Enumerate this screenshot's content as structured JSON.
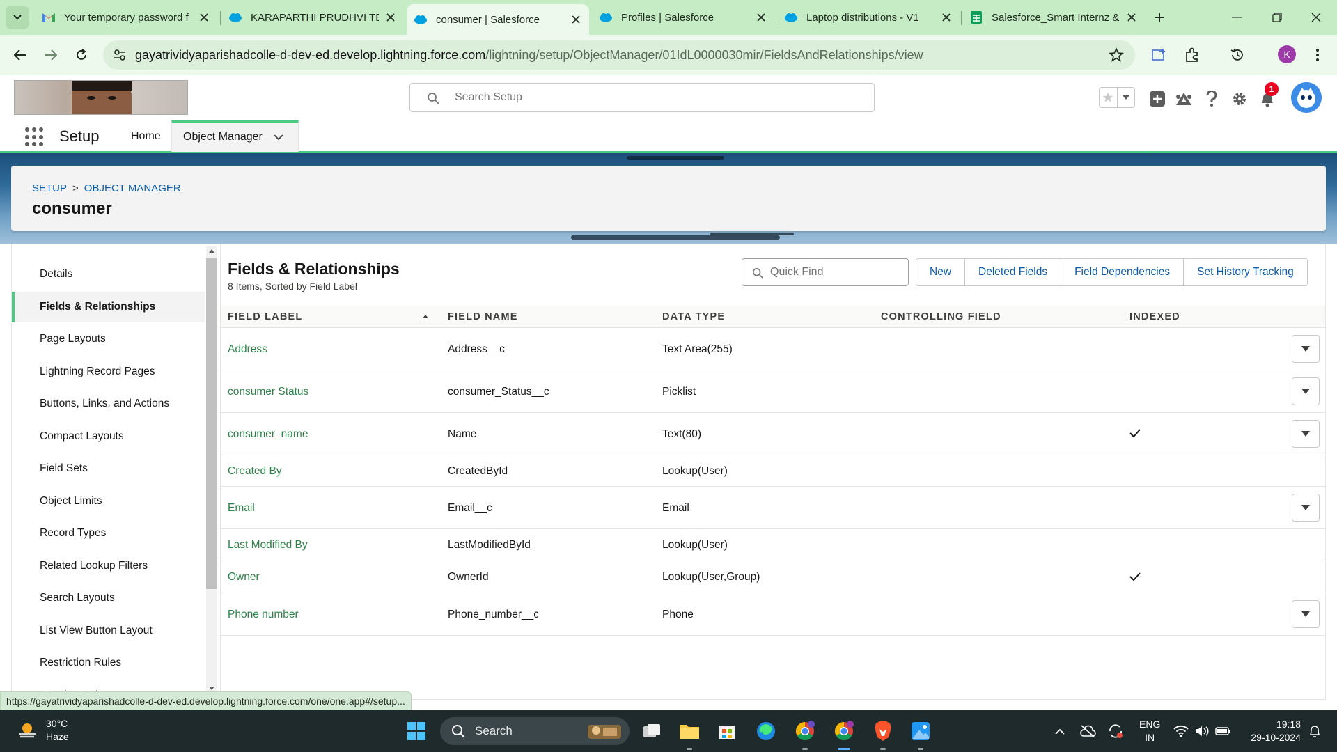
{
  "browser": {
    "tabs": [
      {
        "title": "Your temporary password f",
        "icon": "gmail-icon"
      },
      {
        "title": "KARAPARTHI PRUDHVI TEJ",
        "icon": "salesforce-cloud-icon"
      },
      {
        "title": "consumer | Salesforce",
        "icon": "salesforce-cloud-icon",
        "active": true
      },
      {
        "title": "Profiles | Salesforce",
        "icon": "salesforce-cloud-icon"
      },
      {
        "title": "Laptop distributions - V1",
        "icon": "salesforce-cloud-icon"
      },
      {
        "title": "Salesforce_Smart Internz &",
        "icon": "google-sheets-icon"
      }
    ],
    "url_host": "gayatrividyaparishadcolle-d-dev-ed.develop.lightning.force.com",
    "url_path": "/lightning/setup/ObjectManager/01IdL0000030mir/FieldsAndRelationships/view",
    "profile_initial": "K",
    "status_url": "https://gayatrividyaparishadcolle-d-dev-ed.develop.lightning.force.com/one/one.app#/setup..."
  },
  "header": {
    "search_placeholder": "Search Setup",
    "notification_count": "1"
  },
  "appnav": {
    "app_name": "Setup",
    "items": [
      {
        "label": "Home"
      },
      {
        "label": "Object Manager",
        "active": true
      }
    ]
  },
  "page": {
    "breadcrumb": [
      "SETUP",
      "OBJECT MANAGER"
    ],
    "title": "consumer"
  },
  "sidebar": {
    "items": [
      {
        "label": "Details"
      },
      {
        "label": "Fields & Relationships",
        "active": true
      },
      {
        "label": "Page Layouts"
      },
      {
        "label": "Lightning Record Pages"
      },
      {
        "label": "Buttons, Links, and Actions"
      },
      {
        "label": "Compact Layouts"
      },
      {
        "label": "Field Sets"
      },
      {
        "label": "Object Limits"
      },
      {
        "label": "Record Types"
      },
      {
        "label": "Related Lookup Filters"
      },
      {
        "label": "Search Layouts"
      },
      {
        "label": "List View Button Layout"
      },
      {
        "label": "Restriction Rules"
      },
      {
        "label": "Scoping Rules"
      }
    ]
  },
  "fields": {
    "title": "Fields & Relationships",
    "subtitle": "8 Items, Sorted by Field Label",
    "quick_find_placeholder": "Quick Find",
    "buttons": [
      "New",
      "Deleted Fields",
      "Field Dependencies",
      "Set History Tracking"
    ],
    "columns": [
      "FIELD LABEL",
      "FIELD NAME",
      "DATA TYPE",
      "CONTROLLING FIELD",
      "INDEXED"
    ],
    "rows": [
      {
        "label": "Address",
        "name": "Address__c",
        "type": "Text Area(255)",
        "controlling": "",
        "indexed": false,
        "menu": true
      },
      {
        "label": "consumer Status",
        "name": "consumer_Status__c",
        "type": "Picklist",
        "controlling": "",
        "indexed": false,
        "menu": true
      },
      {
        "label": "consumer_name",
        "name": "Name",
        "type": "Text(80)",
        "controlling": "",
        "indexed": true,
        "menu": true
      },
      {
        "label": "Created By",
        "name": "CreatedById",
        "type": "Lookup(User)",
        "controlling": "",
        "indexed": false,
        "menu": false
      },
      {
        "label": "Email",
        "name": "Email__c",
        "type": "Email",
        "controlling": "",
        "indexed": false,
        "menu": true
      },
      {
        "label": "Last Modified By",
        "name": "LastModifiedById",
        "type": "Lookup(User)",
        "controlling": "",
        "indexed": false,
        "menu": false
      },
      {
        "label": "Owner",
        "name": "OwnerId",
        "type": "Lookup(User,Group)",
        "controlling": "",
        "indexed": true,
        "menu": false
      },
      {
        "label": "Phone number",
        "name": "Phone_number__c",
        "type": "Phone",
        "controlling": "",
        "indexed": false,
        "menu": true
      }
    ]
  },
  "taskbar": {
    "weather_temp": "30°C",
    "weather_desc": "Haze",
    "search_label": "Search",
    "lang_line1": "ENG",
    "lang_line2": "IN",
    "time": "19:18",
    "date": "29-10-2024"
  },
  "colors": {
    "brand_green": "#4bca81",
    "link_green": "#2e844a",
    "link_blue": "#0b5cab",
    "browser_chrome": "#c6ecc5"
  }
}
